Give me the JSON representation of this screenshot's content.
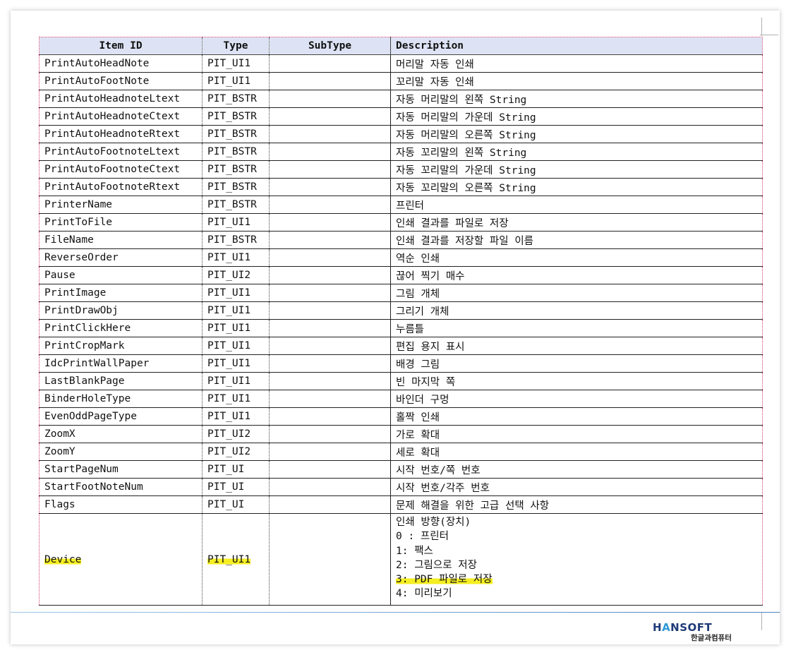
{
  "table": {
    "headers": [
      "Item ID",
      "Type",
      "SubType",
      "Description"
    ],
    "rows": [
      {
        "id": "PrintAutoHeadNote",
        "type": "PIT_UI1",
        "subtype": "",
        "desc": "머리말 자동 인쇄"
      },
      {
        "id": "PrintAutoFootNote",
        "type": "PIT_UI1",
        "subtype": "",
        "desc": "꼬리말 자동 인쇄"
      },
      {
        "id": "PrintAutoHeadnoteLtext",
        "type": "PIT_BSTR",
        "subtype": "",
        "desc": "자동 머리말의 왼쪽 String"
      },
      {
        "id": "PrintAutoHeadnoteCtext",
        "type": "PIT_BSTR",
        "subtype": "",
        "desc": "자동 머리말의 가운데 String"
      },
      {
        "id": "PrintAutoHeadnoteRtext",
        "type": "PIT_BSTR",
        "subtype": "",
        "desc": "자동 머리말의 오른쪽 String"
      },
      {
        "id": "PrintAutoFootnoteLtext",
        "type": "PIT_BSTR",
        "subtype": "",
        "desc": "자동 꼬리말의 왼쪽 String"
      },
      {
        "id": "PrintAutoFootnoteCtext",
        "type": "PIT_BSTR",
        "subtype": "",
        "desc": "자동 꼬리말의 가운데 String"
      },
      {
        "id": "PrintAutoFootnoteRtext",
        "type": "PIT_BSTR",
        "subtype": "",
        "desc": "자동 꼬리말의 오른쪽 String"
      },
      {
        "id": "PrinterName",
        "type": "PIT_BSTR",
        "subtype": "",
        "desc": "프린터"
      },
      {
        "id": "PrintToFile",
        "type": "PIT_UI1",
        "subtype": "",
        "desc": "인쇄 결과를 파일로 저장"
      },
      {
        "id": "FileName",
        "type": "PIT_BSTR",
        "subtype": "",
        "desc": "인쇄 결과를 저장할 파일 이름"
      },
      {
        "id": "ReverseOrder",
        "type": "PIT_UI1",
        "subtype": "",
        "desc": "역순 인쇄"
      },
      {
        "id": "Pause",
        "type": "PIT_UI2",
        "subtype": "",
        "desc": "끊어 찍기 매수"
      },
      {
        "id": "PrintImage",
        "type": "PIT_UI1",
        "subtype": "",
        "desc": "그림 개체"
      },
      {
        "id": "PrintDrawObj",
        "type": "PIT_UI1",
        "subtype": "",
        "desc": "그리기 개체"
      },
      {
        "id": "PrintClickHere",
        "type": "PIT_UI1",
        "subtype": "",
        "desc": "누름틀"
      },
      {
        "id": "PrintCropMark",
        "type": "PIT_UI1",
        "subtype": "",
        "desc": "편집 용지 표시"
      },
      {
        "id": "IdcPrintWallPaper",
        "type": "PIT_UI1",
        "subtype": "",
        "desc": "배경 그림"
      },
      {
        "id": "LastBlankPage",
        "type": "PIT_UI1",
        "subtype": "",
        "desc": "빈 마지막 쪽"
      },
      {
        "id": "BinderHoleType",
        "type": "PIT_UI1",
        "subtype": "",
        "desc": "바인더 구멍"
      },
      {
        "id": "EvenOddPageType",
        "type": "PIT_UI1",
        "subtype": "",
        "desc": "홀짝 인쇄"
      },
      {
        "id": "ZoomX",
        "type": "PIT_UI2",
        "subtype": "",
        "desc": "가로 확대"
      },
      {
        "id": "ZoomY",
        "type": "PIT_UI2",
        "subtype": "",
        "desc": "세로 확대"
      },
      {
        "id": "StartPageNum",
        "type": "PIT_UI",
        "subtype": "",
        "desc": "시작 번호/쪽 번호"
      },
      {
        "id": "StartFootNoteNum",
        "type": "PIT_UI",
        "subtype": "",
        "desc": "시작 번호/각주 번호"
      },
      {
        "id": "Flags",
        "type": "PIT_UI",
        "subtype": "",
        "desc": "문제 해결을 위한 고급 선택 사항"
      }
    ],
    "device_row": {
      "id": "Device",
      "type": "PIT_UI1",
      "subtype": "",
      "desc_lines": [
        "인쇄 방향(장치)",
        "0 : 프린터",
        "1: 팩스",
        "2: 그림으로 저장",
        "3: PDF 파일로 저장",
        "4: 미리보기"
      ]
    }
  },
  "highlight_color": "#f5ee22",
  "logo": {
    "word_pre": "H",
    "word_a": "A",
    "word_post": "NSOFT",
    "subtitle": "한글과컴퓨터"
  }
}
